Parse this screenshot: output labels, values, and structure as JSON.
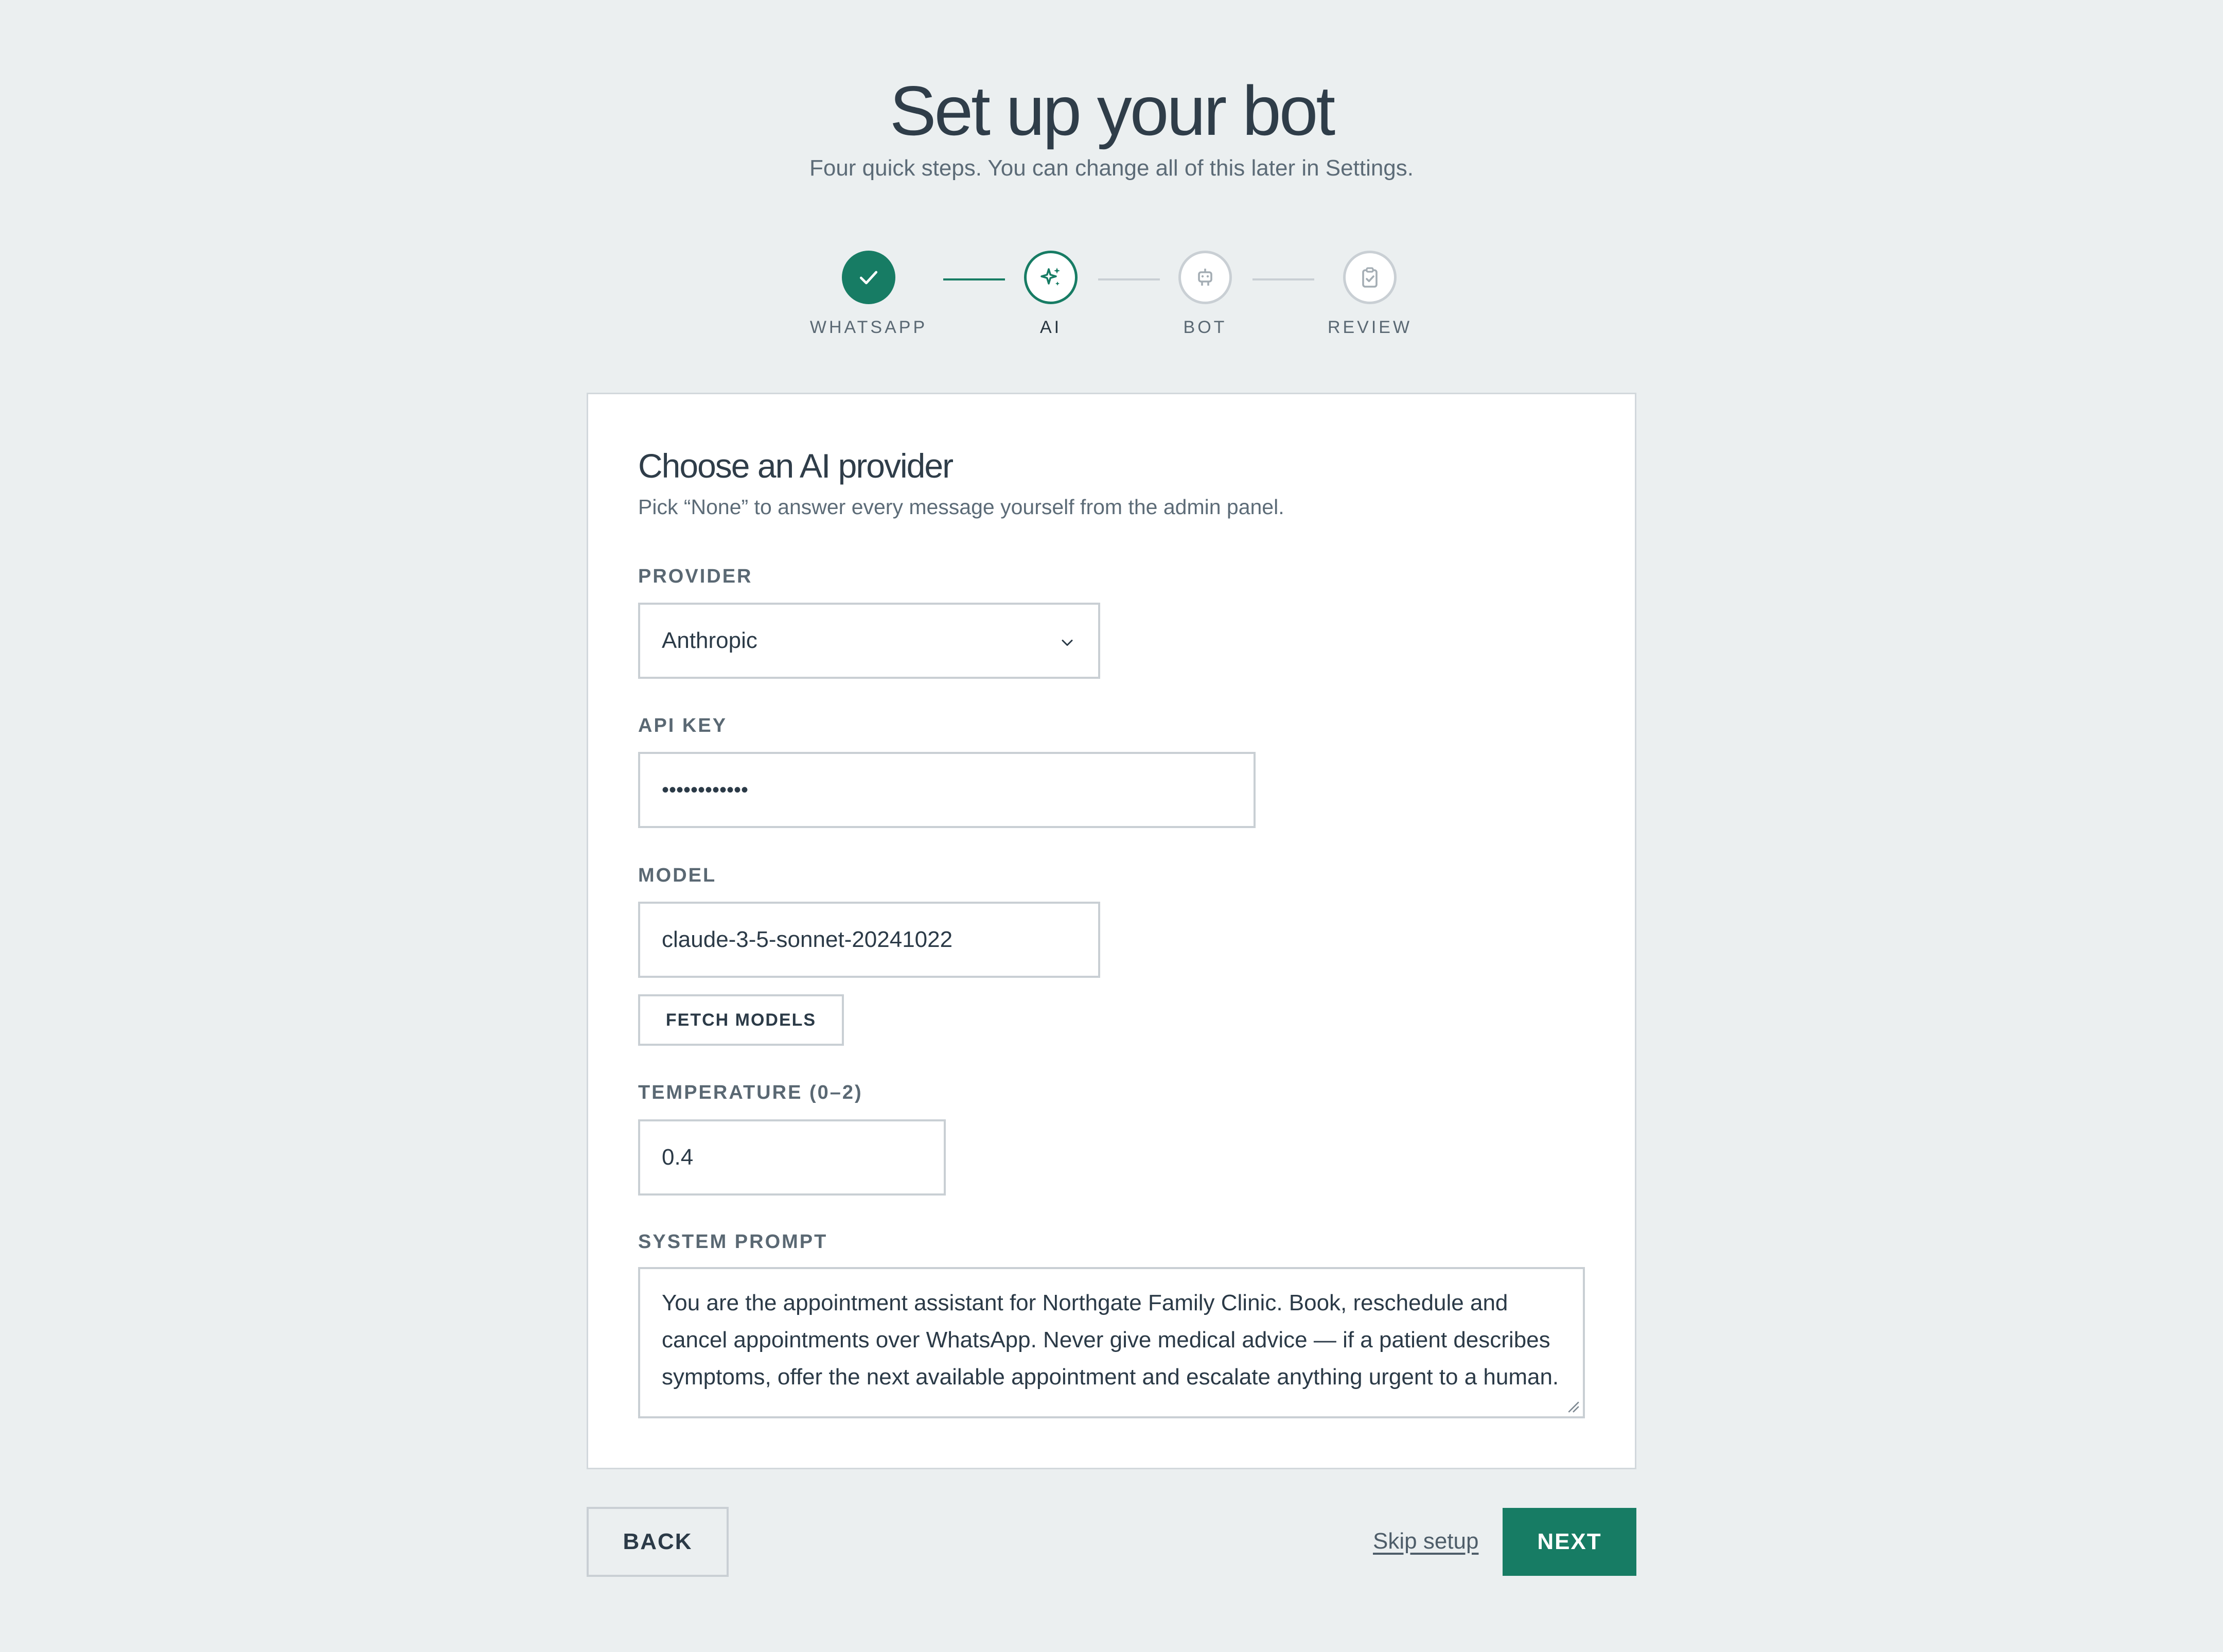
{
  "header": {
    "title": "Set up your bot",
    "subtitle": "Four quick steps. You can change all of this later in Settings."
  },
  "stepper": {
    "steps": [
      {
        "label": "WHATSAPP",
        "state": "done",
        "icon": "check-icon"
      },
      {
        "label": "AI",
        "state": "active",
        "icon": "sparkles-icon"
      },
      {
        "label": "BOT",
        "state": "todo",
        "icon": "robot-icon"
      },
      {
        "label": "REVIEW",
        "state": "todo",
        "icon": "clipboard-check-icon"
      }
    ]
  },
  "card": {
    "title": "Choose an AI provider",
    "description": "Pick “None” to answer every message yourself from the admin panel.",
    "provider": {
      "label": "PROVIDER",
      "value": "Anthropic"
    },
    "api_key": {
      "label": "API KEY",
      "value": "••••••••••••"
    },
    "model": {
      "label": "MODEL",
      "value": "claude-3-5-sonnet-20241022",
      "fetch_label": "FETCH MODELS"
    },
    "temperature": {
      "label": "TEMPERATURE (0–2)",
      "value": "0.4"
    },
    "system_prompt": {
      "label": "SYSTEM PROMPT",
      "value": "You are the appointment assistant for Northgate Family Clinic. Book, reschedule and cancel appointments over WhatsApp. Never give medical advice — if a patient describes symptoms, offer the next available appointment and escalate anything urgent to a human."
    }
  },
  "footer": {
    "back_label": "BACK",
    "skip_label": "Skip setup",
    "next_label": "NEXT"
  },
  "colors": {
    "accent": "#177c64",
    "background": "#ebeff0",
    "inactive": "#c9cfd4"
  }
}
